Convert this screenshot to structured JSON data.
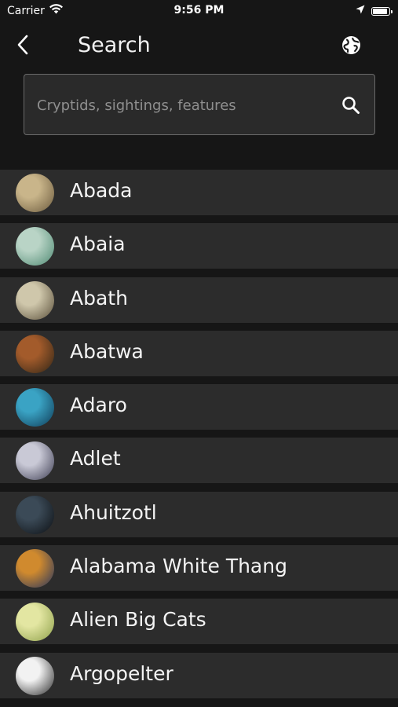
{
  "status_bar": {
    "carrier": "Carrier",
    "time": "9:56 PM",
    "battery_level": 0.95
  },
  "header": {
    "title": "Search",
    "back_icon": "chevron-left-icon",
    "globe_icon": "globe-icon"
  },
  "search": {
    "placeholder": "Cryptids, sightings, features",
    "value": "",
    "icon": "search-icon"
  },
  "list": {
    "items": [
      {
        "label": "Abada",
        "thumb_colors": [
          "#c9b58a",
          "#6b5a3d"
        ]
      },
      {
        "label": "Abaia",
        "thumb_colors": [
          "#b9d4c6",
          "#4f8a73"
        ]
      },
      {
        "label": "Abath",
        "thumb_colors": [
          "#cfc7ab",
          "#5a4f3a"
        ]
      },
      {
        "label": "Abatwa",
        "thumb_colors": [
          "#a35b2b",
          "#2f2516"
        ]
      },
      {
        "label": "Adaro",
        "thumb_colors": [
          "#3aa3c4",
          "#0f3b56"
        ]
      },
      {
        "label": "Adlet",
        "thumb_colors": [
          "#c9c9d6",
          "#3d3d52"
        ]
      },
      {
        "label": "Ahuitzotl",
        "thumb_colors": [
          "#3b4a57",
          "#0c0f13"
        ]
      },
      {
        "label": "Alabama White Thang",
        "thumb_colors": [
          "#d08a2e",
          "#25345e"
        ]
      },
      {
        "label": "Alien Big Cats",
        "thumb_colors": [
          "#e3e6a2",
          "#8ea04a"
        ]
      },
      {
        "label": "Argopelter",
        "thumb_colors": [
          "#f2f2f2",
          "#2b2b2b"
        ]
      }
    ]
  }
}
